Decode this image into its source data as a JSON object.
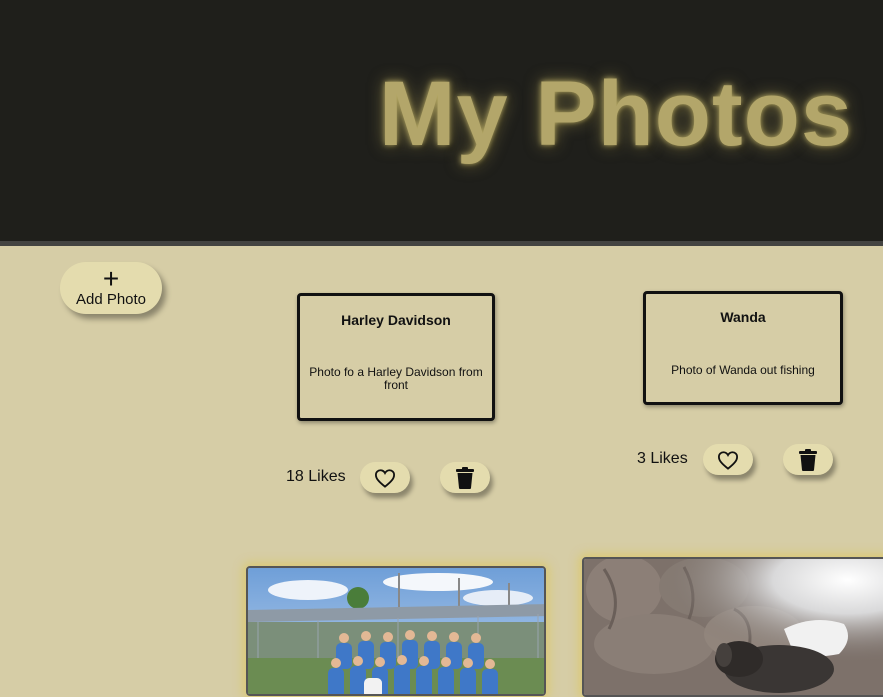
{
  "header": {
    "title": "My Photos"
  },
  "toolbar": {
    "plus_symbol": "+",
    "add_label": "Add Photo"
  },
  "posts": [
    {
      "title": "Harley Davidson",
      "description": "Photo fo a Harley Davidson from front",
      "likes_label": "18 Likes",
      "likes": 18
    },
    {
      "title": "Wanda",
      "description": "Photo of Wanda out fishing",
      "likes_label": "3 Likes",
      "likes": 3
    }
  ],
  "icons": {
    "like": "heart-outline-icon",
    "delete": "trash-icon",
    "add": "plus-icon"
  },
  "colors": {
    "header_bg": "#1f1f1b",
    "title": "#b3a66a",
    "page_bg": "#d6cda6",
    "button_bg": "#e4dcae",
    "photo_glow": "#dcc864"
  }
}
